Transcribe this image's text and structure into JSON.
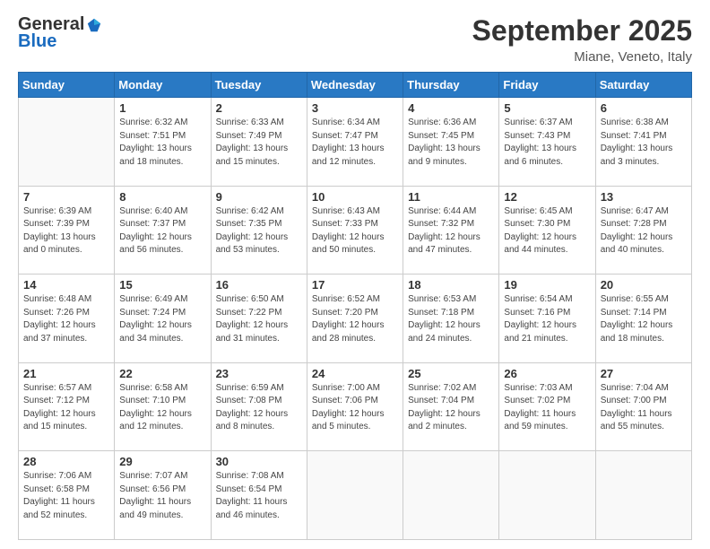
{
  "header": {
    "logo_general": "General",
    "logo_blue": "Blue",
    "month_title": "September 2025",
    "location": "Miane, Veneto, Italy"
  },
  "calendar": {
    "days_of_week": [
      "Sunday",
      "Monday",
      "Tuesday",
      "Wednesday",
      "Thursday",
      "Friday",
      "Saturday"
    ],
    "weeks": [
      [
        {
          "day": "",
          "info": ""
        },
        {
          "day": "1",
          "info": "Sunrise: 6:32 AM\nSunset: 7:51 PM\nDaylight: 13 hours\nand 18 minutes."
        },
        {
          "day": "2",
          "info": "Sunrise: 6:33 AM\nSunset: 7:49 PM\nDaylight: 13 hours\nand 15 minutes."
        },
        {
          "day": "3",
          "info": "Sunrise: 6:34 AM\nSunset: 7:47 PM\nDaylight: 13 hours\nand 12 minutes."
        },
        {
          "day": "4",
          "info": "Sunrise: 6:36 AM\nSunset: 7:45 PM\nDaylight: 13 hours\nand 9 minutes."
        },
        {
          "day": "5",
          "info": "Sunrise: 6:37 AM\nSunset: 7:43 PM\nDaylight: 13 hours\nand 6 minutes."
        },
        {
          "day": "6",
          "info": "Sunrise: 6:38 AM\nSunset: 7:41 PM\nDaylight: 13 hours\nand 3 minutes."
        }
      ],
      [
        {
          "day": "7",
          "info": "Sunrise: 6:39 AM\nSunset: 7:39 PM\nDaylight: 13 hours\nand 0 minutes."
        },
        {
          "day": "8",
          "info": "Sunrise: 6:40 AM\nSunset: 7:37 PM\nDaylight: 12 hours\nand 56 minutes."
        },
        {
          "day": "9",
          "info": "Sunrise: 6:42 AM\nSunset: 7:35 PM\nDaylight: 12 hours\nand 53 minutes."
        },
        {
          "day": "10",
          "info": "Sunrise: 6:43 AM\nSunset: 7:33 PM\nDaylight: 12 hours\nand 50 minutes."
        },
        {
          "day": "11",
          "info": "Sunrise: 6:44 AM\nSunset: 7:32 PM\nDaylight: 12 hours\nand 47 minutes."
        },
        {
          "day": "12",
          "info": "Sunrise: 6:45 AM\nSunset: 7:30 PM\nDaylight: 12 hours\nand 44 minutes."
        },
        {
          "day": "13",
          "info": "Sunrise: 6:47 AM\nSunset: 7:28 PM\nDaylight: 12 hours\nand 40 minutes."
        }
      ],
      [
        {
          "day": "14",
          "info": "Sunrise: 6:48 AM\nSunset: 7:26 PM\nDaylight: 12 hours\nand 37 minutes."
        },
        {
          "day": "15",
          "info": "Sunrise: 6:49 AM\nSunset: 7:24 PM\nDaylight: 12 hours\nand 34 minutes."
        },
        {
          "day": "16",
          "info": "Sunrise: 6:50 AM\nSunset: 7:22 PM\nDaylight: 12 hours\nand 31 minutes."
        },
        {
          "day": "17",
          "info": "Sunrise: 6:52 AM\nSunset: 7:20 PM\nDaylight: 12 hours\nand 28 minutes."
        },
        {
          "day": "18",
          "info": "Sunrise: 6:53 AM\nSunset: 7:18 PM\nDaylight: 12 hours\nand 24 minutes."
        },
        {
          "day": "19",
          "info": "Sunrise: 6:54 AM\nSunset: 7:16 PM\nDaylight: 12 hours\nand 21 minutes."
        },
        {
          "day": "20",
          "info": "Sunrise: 6:55 AM\nSunset: 7:14 PM\nDaylight: 12 hours\nand 18 minutes."
        }
      ],
      [
        {
          "day": "21",
          "info": "Sunrise: 6:57 AM\nSunset: 7:12 PM\nDaylight: 12 hours\nand 15 minutes."
        },
        {
          "day": "22",
          "info": "Sunrise: 6:58 AM\nSunset: 7:10 PM\nDaylight: 12 hours\nand 12 minutes."
        },
        {
          "day": "23",
          "info": "Sunrise: 6:59 AM\nSunset: 7:08 PM\nDaylight: 12 hours\nand 8 minutes."
        },
        {
          "day": "24",
          "info": "Sunrise: 7:00 AM\nSunset: 7:06 PM\nDaylight: 12 hours\nand 5 minutes."
        },
        {
          "day": "25",
          "info": "Sunrise: 7:02 AM\nSunset: 7:04 PM\nDaylight: 12 hours\nand 2 minutes."
        },
        {
          "day": "26",
          "info": "Sunrise: 7:03 AM\nSunset: 7:02 PM\nDaylight: 11 hours\nand 59 minutes."
        },
        {
          "day": "27",
          "info": "Sunrise: 7:04 AM\nSunset: 7:00 PM\nDaylight: 11 hours\nand 55 minutes."
        }
      ],
      [
        {
          "day": "28",
          "info": "Sunrise: 7:06 AM\nSunset: 6:58 PM\nDaylight: 11 hours\nand 52 minutes."
        },
        {
          "day": "29",
          "info": "Sunrise: 7:07 AM\nSunset: 6:56 PM\nDaylight: 11 hours\nand 49 minutes."
        },
        {
          "day": "30",
          "info": "Sunrise: 7:08 AM\nSunset: 6:54 PM\nDaylight: 11 hours\nand 46 minutes."
        },
        {
          "day": "",
          "info": ""
        },
        {
          "day": "",
          "info": ""
        },
        {
          "day": "",
          "info": ""
        },
        {
          "day": "",
          "info": ""
        }
      ]
    ]
  }
}
